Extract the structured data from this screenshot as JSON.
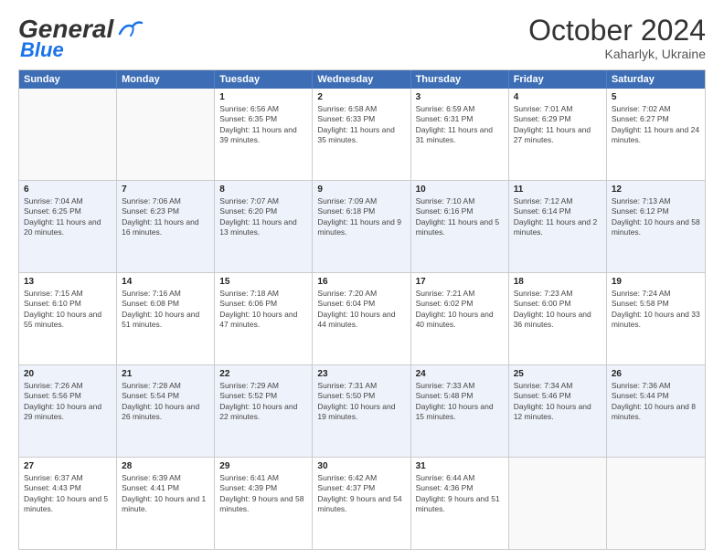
{
  "header": {
    "logo_general": "General",
    "logo_blue": "Blue",
    "month": "October 2024",
    "location": "Kaharlyk, Ukraine"
  },
  "days": [
    "Sunday",
    "Monday",
    "Tuesday",
    "Wednesday",
    "Thursday",
    "Friday",
    "Saturday"
  ],
  "rows": [
    [
      {
        "day": "",
        "sunrise": "",
        "sunset": "",
        "daylight": "",
        "empty": true
      },
      {
        "day": "",
        "sunrise": "",
        "sunset": "",
        "daylight": "",
        "empty": true
      },
      {
        "day": "1",
        "sunrise": "Sunrise: 6:56 AM",
        "sunset": "Sunset: 6:35 PM",
        "daylight": "Daylight: 11 hours and 39 minutes."
      },
      {
        "day": "2",
        "sunrise": "Sunrise: 6:58 AM",
        "sunset": "Sunset: 6:33 PM",
        "daylight": "Daylight: 11 hours and 35 minutes."
      },
      {
        "day": "3",
        "sunrise": "Sunrise: 6:59 AM",
        "sunset": "Sunset: 6:31 PM",
        "daylight": "Daylight: 11 hours and 31 minutes."
      },
      {
        "day": "4",
        "sunrise": "Sunrise: 7:01 AM",
        "sunset": "Sunset: 6:29 PM",
        "daylight": "Daylight: 11 hours and 27 minutes."
      },
      {
        "day": "5",
        "sunrise": "Sunrise: 7:02 AM",
        "sunset": "Sunset: 6:27 PM",
        "daylight": "Daylight: 11 hours and 24 minutes."
      }
    ],
    [
      {
        "day": "6",
        "sunrise": "Sunrise: 7:04 AM",
        "sunset": "Sunset: 6:25 PM",
        "daylight": "Daylight: 11 hours and 20 minutes."
      },
      {
        "day": "7",
        "sunrise": "Sunrise: 7:06 AM",
        "sunset": "Sunset: 6:23 PM",
        "daylight": "Daylight: 11 hours and 16 minutes."
      },
      {
        "day": "8",
        "sunrise": "Sunrise: 7:07 AM",
        "sunset": "Sunset: 6:20 PM",
        "daylight": "Daylight: 11 hours and 13 minutes."
      },
      {
        "day": "9",
        "sunrise": "Sunrise: 7:09 AM",
        "sunset": "Sunset: 6:18 PM",
        "daylight": "Daylight: 11 hours and 9 minutes."
      },
      {
        "day": "10",
        "sunrise": "Sunrise: 7:10 AM",
        "sunset": "Sunset: 6:16 PM",
        "daylight": "Daylight: 11 hours and 5 minutes."
      },
      {
        "day": "11",
        "sunrise": "Sunrise: 7:12 AM",
        "sunset": "Sunset: 6:14 PM",
        "daylight": "Daylight: 11 hours and 2 minutes."
      },
      {
        "day": "12",
        "sunrise": "Sunrise: 7:13 AM",
        "sunset": "Sunset: 6:12 PM",
        "daylight": "Daylight: 10 hours and 58 minutes."
      }
    ],
    [
      {
        "day": "13",
        "sunrise": "Sunrise: 7:15 AM",
        "sunset": "Sunset: 6:10 PM",
        "daylight": "Daylight: 10 hours and 55 minutes."
      },
      {
        "day": "14",
        "sunrise": "Sunrise: 7:16 AM",
        "sunset": "Sunset: 6:08 PM",
        "daylight": "Daylight: 10 hours and 51 minutes."
      },
      {
        "day": "15",
        "sunrise": "Sunrise: 7:18 AM",
        "sunset": "Sunset: 6:06 PM",
        "daylight": "Daylight: 10 hours and 47 minutes."
      },
      {
        "day": "16",
        "sunrise": "Sunrise: 7:20 AM",
        "sunset": "Sunset: 6:04 PM",
        "daylight": "Daylight: 10 hours and 44 minutes."
      },
      {
        "day": "17",
        "sunrise": "Sunrise: 7:21 AM",
        "sunset": "Sunset: 6:02 PM",
        "daylight": "Daylight: 10 hours and 40 minutes."
      },
      {
        "day": "18",
        "sunrise": "Sunrise: 7:23 AM",
        "sunset": "Sunset: 6:00 PM",
        "daylight": "Daylight: 10 hours and 36 minutes."
      },
      {
        "day": "19",
        "sunrise": "Sunrise: 7:24 AM",
        "sunset": "Sunset: 5:58 PM",
        "daylight": "Daylight: 10 hours and 33 minutes."
      }
    ],
    [
      {
        "day": "20",
        "sunrise": "Sunrise: 7:26 AM",
        "sunset": "Sunset: 5:56 PM",
        "daylight": "Daylight: 10 hours and 29 minutes."
      },
      {
        "day": "21",
        "sunrise": "Sunrise: 7:28 AM",
        "sunset": "Sunset: 5:54 PM",
        "daylight": "Daylight: 10 hours and 26 minutes."
      },
      {
        "day": "22",
        "sunrise": "Sunrise: 7:29 AM",
        "sunset": "Sunset: 5:52 PM",
        "daylight": "Daylight: 10 hours and 22 minutes."
      },
      {
        "day": "23",
        "sunrise": "Sunrise: 7:31 AM",
        "sunset": "Sunset: 5:50 PM",
        "daylight": "Daylight: 10 hours and 19 minutes."
      },
      {
        "day": "24",
        "sunrise": "Sunrise: 7:33 AM",
        "sunset": "Sunset: 5:48 PM",
        "daylight": "Daylight: 10 hours and 15 minutes."
      },
      {
        "day": "25",
        "sunrise": "Sunrise: 7:34 AM",
        "sunset": "Sunset: 5:46 PM",
        "daylight": "Daylight: 10 hours and 12 minutes."
      },
      {
        "day": "26",
        "sunrise": "Sunrise: 7:36 AM",
        "sunset": "Sunset: 5:44 PM",
        "daylight": "Daylight: 10 hours and 8 minutes."
      }
    ],
    [
      {
        "day": "27",
        "sunrise": "Sunrise: 6:37 AM",
        "sunset": "Sunset: 4:43 PM",
        "daylight": "Daylight: 10 hours and 5 minutes."
      },
      {
        "day": "28",
        "sunrise": "Sunrise: 6:39 AM",
        "sunset": "Sunset: 4:41 PM",
        "daylight": "Daylight: 10 hours and 1 minute."
      },
      {
        "day": "29",
        "sunrise": "Sunrise: 6:41 AM",
        "sunset": "Sunset: 4:39 PM",
        "daylight": "Daylight: 9 hours and 58 minutes."
      },
      {
        "day": "30",
        "sunrise": "Sunrise: 6:42 AM",
        "sunset": "Sunset: 4:37 PM",
        "daylight": "Daylight: 9 hours and 54 minutes."
      },
      {
        "day": "31",
        "sunrise": "Sunrise: 6:44 AM",
        "sunset": "Sunset: 4:36 PM",
        "daylight": "Daylight: 9 hours and 51 minutes."
      },
      {
        "day": "",
        "sunrise": "",
        "sunset": "",
        "daylight": "",
        "empty": true
      },
      {
        "day": "",
        "sunrise": "",
        "sunset": "",
        "daylight": "",
        "empty": true
      }
    ]
  ]
}
